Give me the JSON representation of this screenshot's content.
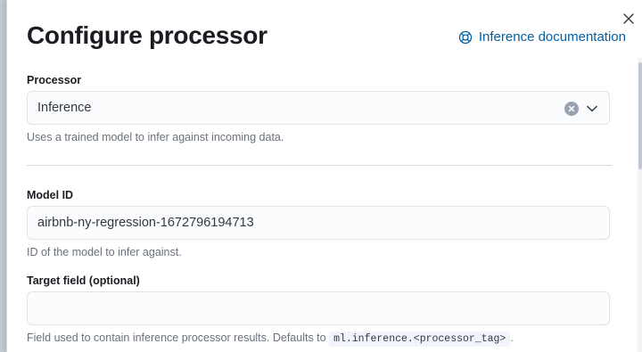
{
  "flyout": {
    "title": "Configure processor",
    "doc_link": "Inference documentation",
    "icons": {
      "close": "close-icon",
      "doc": "help-lifebuoy-icon",
      "clear": "clear-icon",
      "chevron": "chevron-down-icon"
    }
  },
  "processor": {
    "label": "Processor",
    "value": "Inference",
    "help": "Uses a trained model to infer against incoming data."
  },
  "model_id": {
    "label": "Model ID",
    "value": "airbnb-ny-regression-1672796194713",
    "help": "ID of the model to infer against."
  },
  "target_field": {
    "label": "Target field (optional)",
    "value": "",
    "help_prefix": "Field used to contain inference processor results. Defaults to",
    "help_code": "ml.inference.<processor_tag>",
    "help_suffix": "."
  },
  "colors": {
    "link": "#0061a6",
    "title": "#1a1c21",
    "help": "#69707d"
  }
}
